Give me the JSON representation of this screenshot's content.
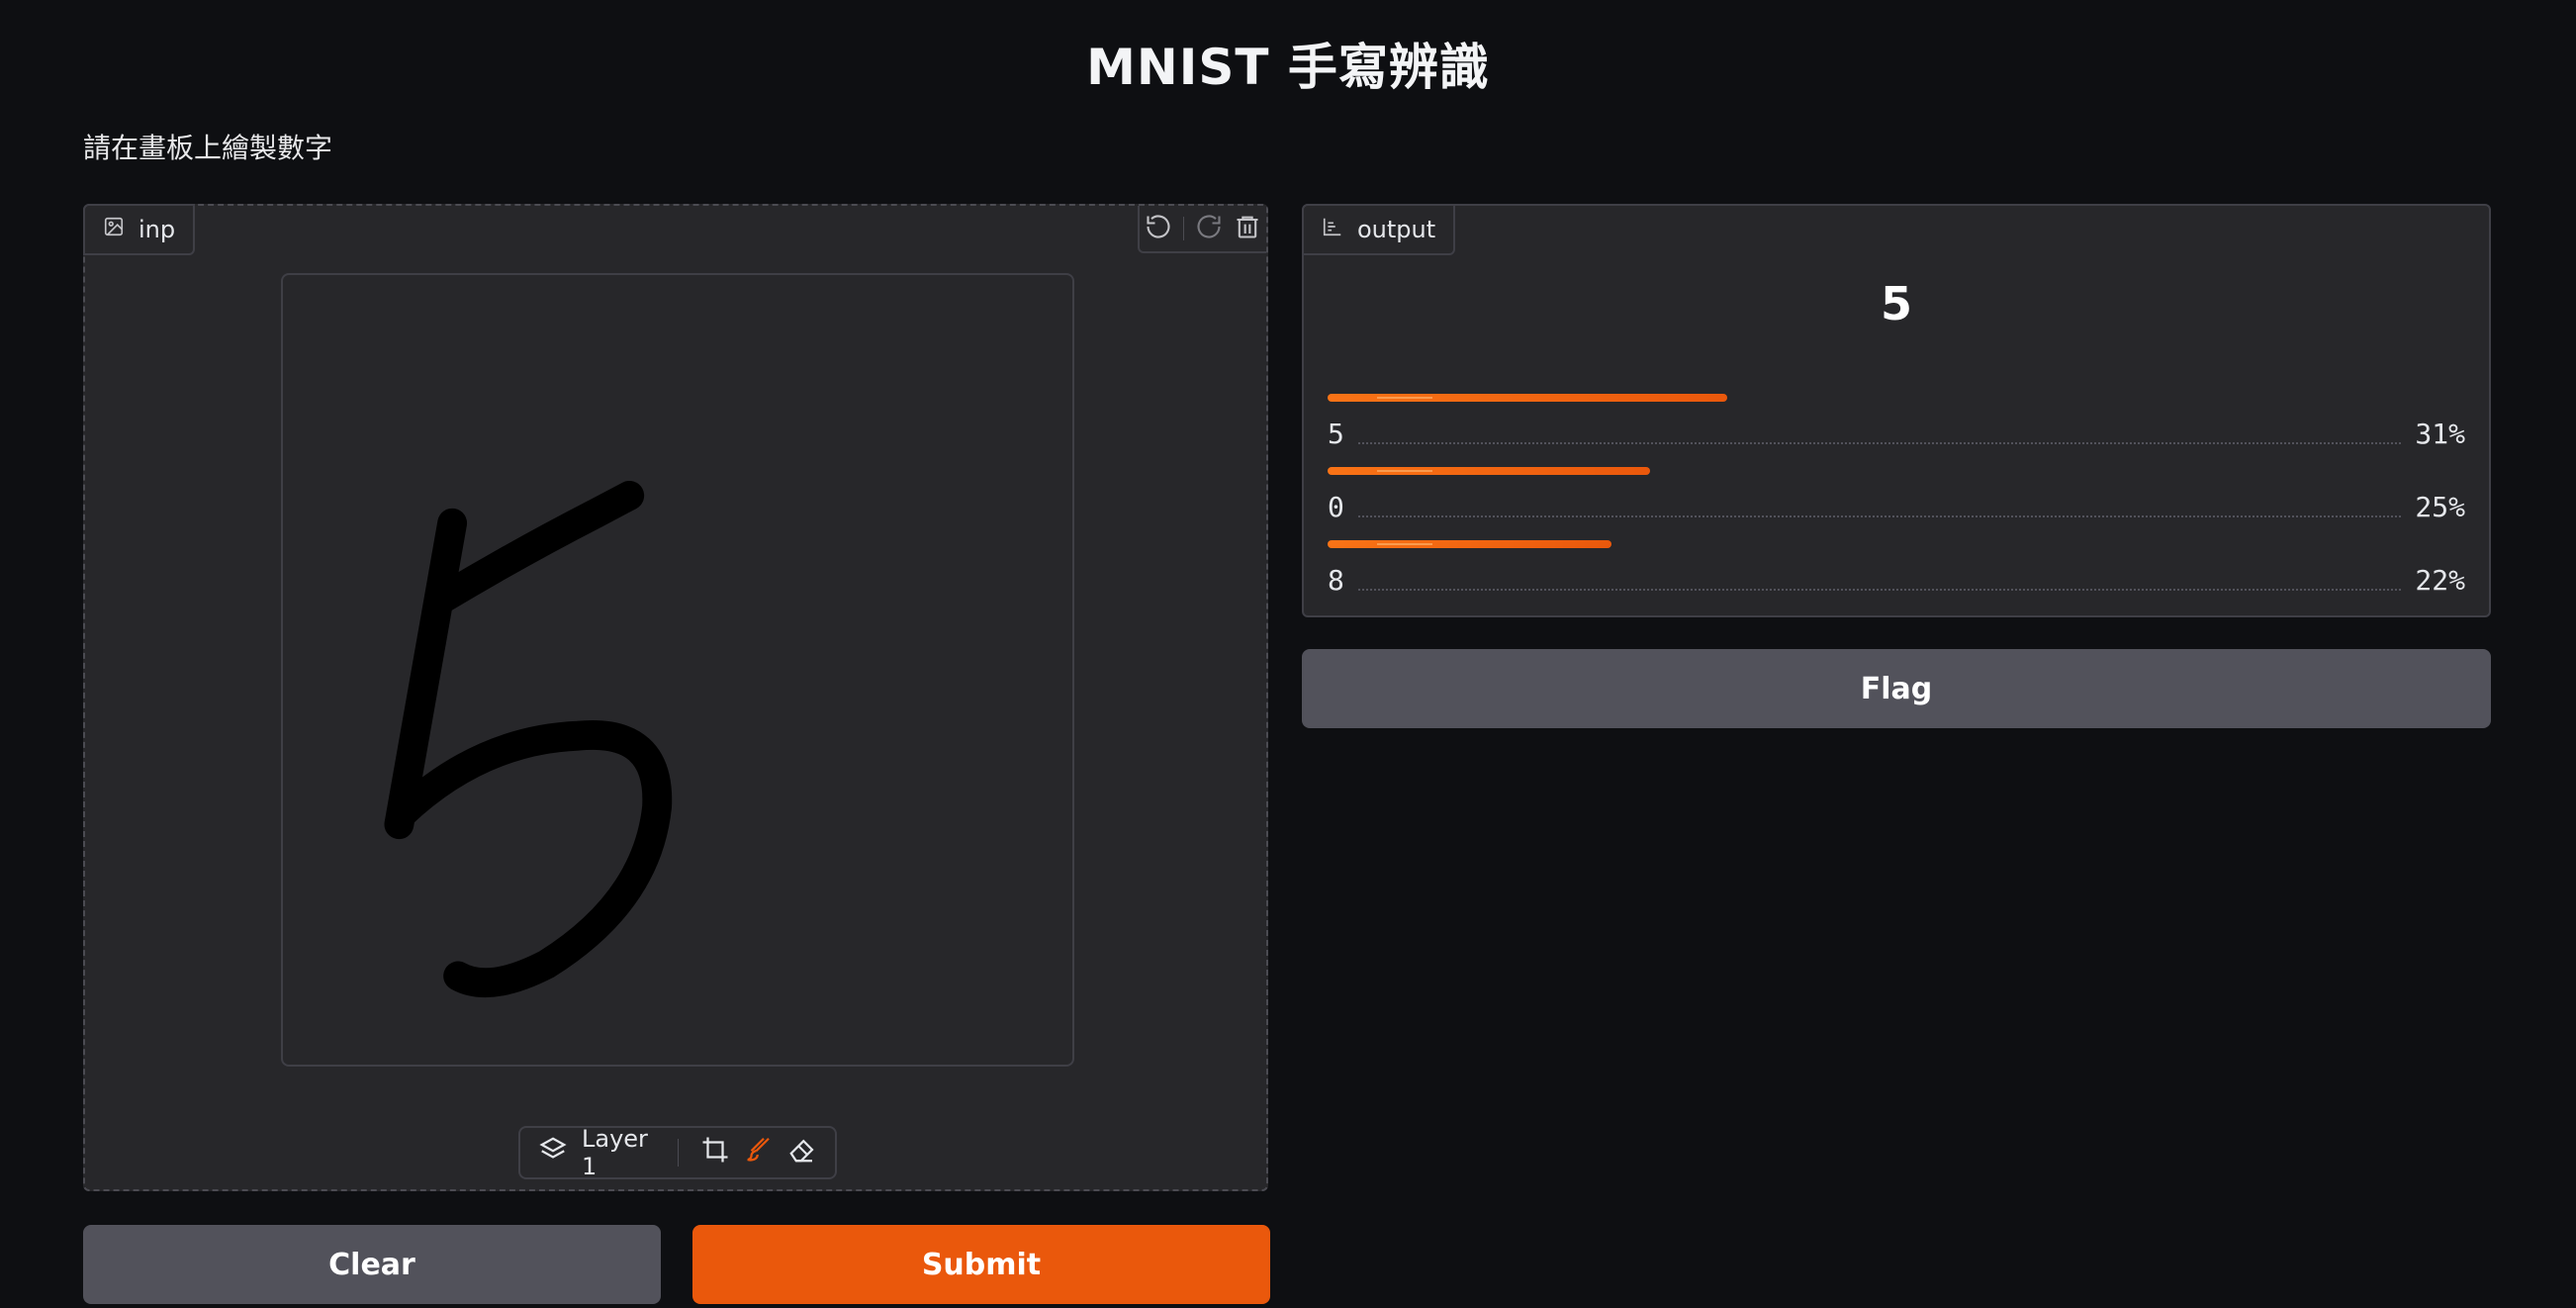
{
  "app": {
    "title": "MNIST 手寫辨識",
    "description": "請在畫板上繪製數字"
  },
  "input": {
    "label": "inp",
    "layer_label": "Layer 1",
    "icons": [
      "image-icon",
      "undo-icon",
      "redo-icon",
      "trash-icon",
      "layers-icon",
      "crop-icon",
      "brush-icon",
      "eraser-icon"
    ]
  },
  "output": {
    "label": "output",
    "top_label": "5",
    "confidences": [
      {
        "label": "5",
        "percent": "31%",
        "value": 0.31
      },
      {
        "label": "0",
        "percent": "25%",
        "value": 0.25
      },
      {
        "label": "8",
        "percent": "22%",
        "value": 0.22
      }
    ]
  },
  "buttons": {
    "flag": "Flag",
    "clear": "Clear",
    "submit": "Submit"
  },
  "colors": {
    "accent": "#ea580c",
    "background": "#0e0f12",
    "panel": "#27272a",
    "secondary_button": "#52525b"
  }
}
